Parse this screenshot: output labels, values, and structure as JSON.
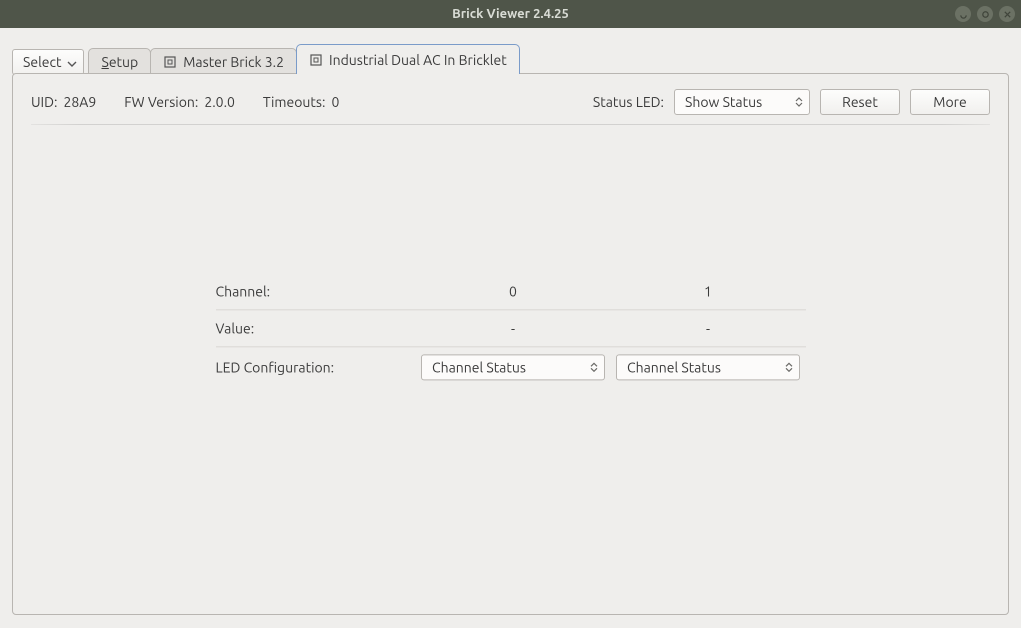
{
  "window": {
    "title": "Brick Viewer 2.4.25"
  },
  "toolbar": {
    "select_label": "Select"
  },
  "tabs": {
    "setup": "Setup",
    "master": "Master Brick 3.2",
    "bricklet": "Industrial Dual AC In Bricklet"
  },
  "info": {
    "uid_label": "UID:",
    "uid_value": "28A9",
    "fw_label": "FW Version:",
    "fw_value": "2.0.0",
    "timeouts_label": "Timeouts:",
    "timeouts_value": "0",
    "status_led_label": "Status LED:",
    "status_led_value": "Show Status",
    "reset_label": "Reset",
    "more_label": "More"
  },
  "table": {
    "channel_label": "Channel:",
    "channel_0": "0",
    "channel_1": "1",
    "value_label": "Value:",
    "value_0": "-",
    "value_1": "-",
    "ledcfg_label": "LED Configuration:",
    "ledcfg_0": "Channel Status",
    "ledcfg_1": "Channel Status"
  }
}
